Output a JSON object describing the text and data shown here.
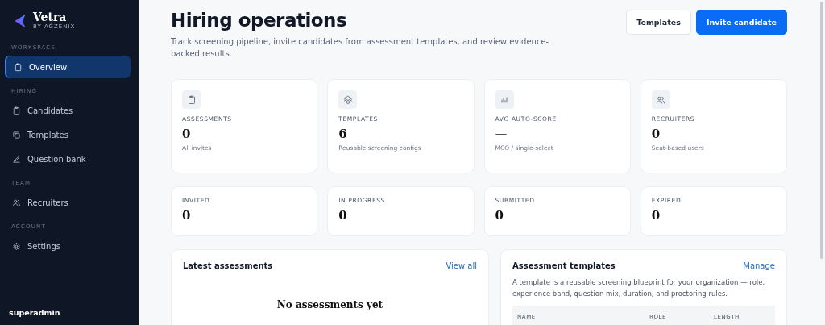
{
  "brand": {
    "name": "Vetra",
    "tagline": "BY AGZENIX"
  },
  "sidebar": {
    "sections": [
      {
        "title": "WORKSPACE",
        "items": [
          {
            "label": "Overview",
            "kind": "clipboard",
            "selected": true
          }
        ]
      },
      {
        "title": "HIRING",
        "items": [
          {
            "label": "Candidates",
            "kind": "clipboard",
            "selected": false
          },
          {
            "label": "Templates",
            "kind": "copy",
            "selected": false
          },
          {
            "label": "Question bank",
            "kind": "pen",
            "selected": false
          }
        ]
      },
      {
        "title": "TEAM",
        "items": [
          {
            "label": "Recruiters",
            "kind": "users",
            "selected": false
          }
        ]
      },
      {
        "title": "ACCOUNT",
        "items": [
          {
            "label": "Settings",
            "kind": "gear",
            "selected": false
          }
        ]
      }
    ],
    "user": "superadmin"
  },
  "header": {
    "title": "Hiring operations",
    "subtitle": "Track screening pipeline, invite candidates from assessment templates, and review evidence-backed results.",
    "buttons": [
      {
        "label": "Templates",
        "kind": "secondary"
      },
      {
        "label": "Invite candidate",
        "kind": "primary"
      }
    ]
  },
  "stats": [
    {
      "kind": "clipboard",
      "label": "ASSESSMENTS",
      "value": "0",
      "note": "All invites"
    },
    {
      "kind": "layers",
      "label": "TEMPLATES",
      "value": "6",
      "note": "Reusable screening configs"
    },
    {
      "kind": "bars",
      "label": "AVG AUTO-SCORE",
      "value": "—",
      "note": "MCQ / single-select"
    },
    {
      "kind": "users",
      "label": "RECRUITERS",
      "value": "0",
      "note": "Seat-based users"
    }
  ],
  "statuses": [
    {
      "label": "INVITED",
      "value": "0"
    },
    {
      "label": "IN PROGRESS",
      "value": "0"
    },
    {
      "label": "SUBMITTED",
      "value": "0"
    },
    {
      "label": "EXPIRED",
      "value": "0"
    }
  ],
  "latest": {
    "title": "Latest assessments",
    "link": "View all",
    "empty_title": "No assessments yet"
  },
  "templates_panel": {
    "title": "Assessment templates",
    "link": "Manage",
    "description": "A template is a reusable screening blueprint for your organization — role, experience band, question mix, duration, and proctoring rules.",
    "columns": [
      "NAME",
      "ROLE",
      "LENGTH"
    ]
  }
}
